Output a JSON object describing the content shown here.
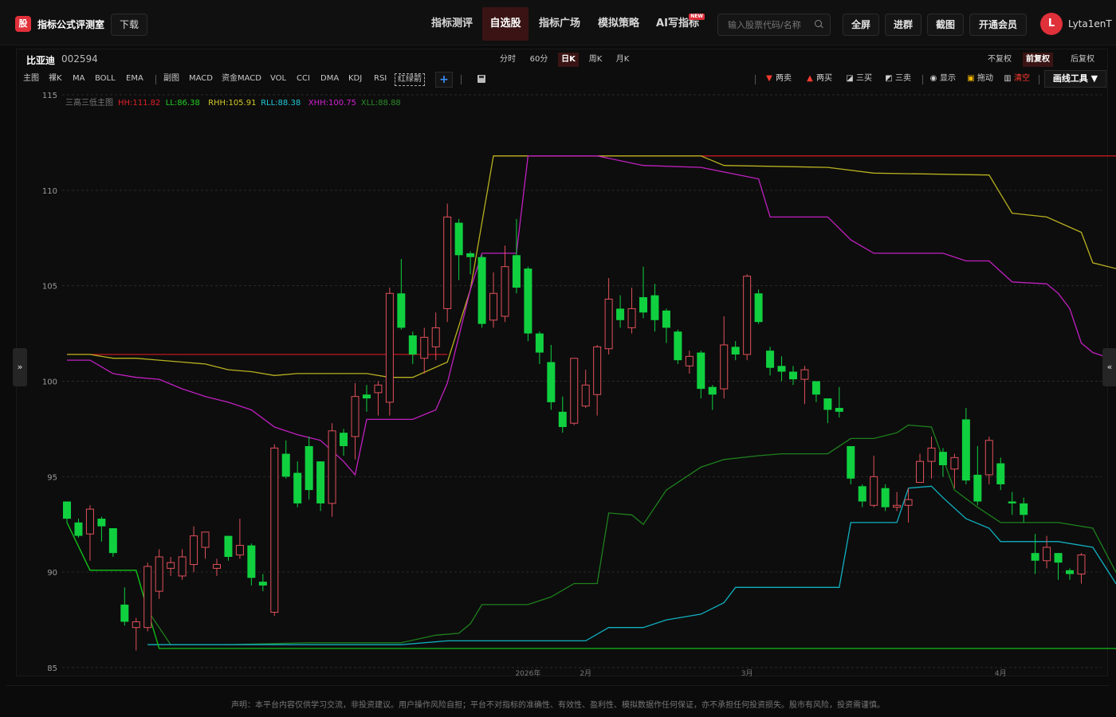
{
  "header": {
    "logo_text": "股",
    "brand": "指标公式评测室",
    "download": "下载",
    "nav": [
      {
        "label": "指标测评",
        "active": false
      },
      {
        "label": "自选股",
        "active": true
      },
      {
        "label": "指标广场",
        "active": false
      },
      {
        "label": "模拟策略",
        "active": false
      },
      {
        "label": "AI写指标",
        "active": false,
        "badge": "NEW"
      }
    ],
    "search_placeholder": "输入股票代码/名称",
    "buttons": [
      "全屏",
      "进群",
      "截图",
      "开通会员"
    ],
    "avatar_letter": "L",
    "username": "Lyta1enT"
  },
  "stock": {
    "name": "比亚迪",
    "code": "002594"
  },
  "periods": [
    {
      "label": "分时",
      "active": false
    },
    {
      "label": "60分",
      "active": false
    },
    {
      "label": "日K",
      "active": true
    },
    {
      "label": "周K",
      "active": false
    },
    {
      "label": "月K",
      "active": false
    }
  ],
  "adjust": [
    {
      "label": "不复权",
      "active": false
    },
    {
      "label": "前复权",
      "active": true
    },
    {
      "label": "后复权",
      "active": false
    }
  ],
  "indicators": [
    "主图",
    "裸K",
    "MA",
    "BOLL",
    "EMA",
    "副图",
    "MACD",
    "资金MACD",
    "VOL",
    "CCI",
    "DMA",
    "KDJ",
    "RSI",
    "红绿箭"
  ],
  "tools": [
    {
      "label": "两卖",
      "glyph": "▼",
      "color": "#ff3b30"
    },
    {
      "label": "两买",
      "glyph": "▲",
      "color": "#ff3b30"
    },
    {
      "label": "三买",
      "glyph": "◪",
      "color": "#cccccc"
    },
    {
      "label": "三卖",
      "glyph": "◩",
      "color": "#cccccc"
    },
    {
      "label": "显示",
      "glyph": "◉",
      "color": "#cccccc"
    },
    {
      "label": "拖动",
      "glyph": "▣",
      "color": "#f0b400"
    },
    {
      "label": "清空",
      "glyph": "▥",
      "color": "#cccccc"
    }
  ],
  "draw_tool": "画线工具 ▼",
  "side_tabs": {
    "left": "»",
    "right": "«"
  },
  "legend": {
    "name": "三高三低主图",
    "items": [
      {
        "text": "HH:111.82",
        "color": "#e0202a"
      },
      {
        "text": "LL:86.38",
        "color": "#22cc22"
      },
      {
        "text": "RHH:105.91",
        "color": "#d4c82a"
      },
      {
        "text": "RLL:88.38",
        "color": "#20c8d8"
      },
      {
        "text": "XHH:100.75",
        "color": "#d020d0"
      },
      {
        "text": "XLL:88.88",
        "color": "#2a8a2a"
      }
    ]
  },
  "colors": {
    "up": "#e0505a",
    "down": "#10d040",
    "bg": "#0d0d0d"
  },
  "chart_data": {
    "type": "candlestick",
    "ylim": [
      85,
      115
    ],
    "yticks": [
      85,
      90,
      95,
      100,
      105,
      110,
      115
    ],
    "xticks": [
      {
        "label": "2026年",
        "index": 40
      },
      {
        "label": "2月",
        "index": 45
      },
      {
        "label": "3月",
        "index": 59
      },
      {
        "label": "4月",
        "index": 81
      }
    ],
    "candles": [
      [
        93.7,
        92.8,
        93.7,
        92.6
      ],
      [
        92.6,
        91.9,
        92.8,
        91.8
      ],
      [
        92.0,
        93.3,
        93.5,
        90.6
      ],
      [
        92.8,
        92.4,
        92.9,
        91.6
      ],
      [
        92.3,
        91.0,
        92.3,
        90.8
      ],
      [
        88.3,
        87.4,
        89.2,
        87.2
      ],
      [
        87.1,
        87.4,
        87.6,
        85.9
      ],
      [
        87.1,
        90.3,
        90.5,
        86.9
      ],
      [
        89.0,
        90.8,
        91.2,
        88.6
      ],
      [
        90.2,
        90.5,
        90.8,
        89.8
      ],
      [
        89.8,
        90.8,
        91.2,
        89.6
      ],
      [
        90.4,
        91.9,
        92.4,
        90.0
      ],
      [
        91.3,
        92.1,
        92.1,
        90.7
      ],
      [
        90.2,
        90.4,
        90.7,
        89.8
      ],
      [
        91.9,
        90.8,
        91.9,
        90.6
      ],
      [
        90.9,
        91.4,
        92.8,
        90.7
      ],
      [
        91.4,
        89.7,
        91.5,
        89.3
      ],
      [
        89.5,
        89.3,
        89.9,
        89.0
      ],
      [
        87.9,
        96.5,
        96.7,
        87.7
      ],
      [
        96.2,
        95.0,
        96.9,
        94.9
      ],
      [
        95.2,
        93.6,
        95.8,
        93.4
      ],
      [
        96.6,
        94.3,
        97.1,
        93.8
      ],
      [
        95.8,
        93.6,
        95.8,
        93.2
      ],
      [
        93.6,
        97.4,
        97.8,
        92.9
      ],
      [
        97.3,
        96.6,
        97.5,
        96.1
      ],
      [
        97.1,
        99.2,
        99.9,
        95.9
      ],
      [
        99.3,
        99.1,
        99.8,
        98.4
      ],
      [
        99.4,
        99.8,
        100.0,
        98.2
      ],
      [
        98.9,
        104.6,
        104.9,
        98.2
      ],
      [
        104.6,
        102.8,
        106.4,
        102.7
      ],
      [
        102.4,
        101.4,
        102.6,
        100.9
      ],
      [
        101.2,
        102.3,
        102.8,
        100.4
      ],
      [
        101.8,
        102.8,
        103.6,
        101.1
      ],
      [
        103.8,
        108.6,
        109.3,
        103.1
      ],
      [
        108.3,
        106.6,
        108.5,
        105.3
      ],
      [
        106.7,
        106.5,
        106.8,
        105.6
      ],
      [
        106.5,
        103.0,
        106.6,
        102.8
      ],
      [
        103.2,
        104.6,
        105.7,
        102.8
      ],
      [
        103.4,
        106.0,
        107.1,
        103.1
      ],
      [
        106.6,
        104.9,
        108.5,
        104.6
      ],
      [
        105.9,
        102.5,
        106.0,
        102.1
      ],
      [
        102.5,
        101.5,
        102.6,
        100.9
      ],
      [
        101.0,
        98.9,
        101.9,
        98.5
      ],
      [
        98.4,
        97.6,
        99.2,
        97.3
      ],
      [
        97.8,
        101.2,
        101.2,
        97.7
      ],
      [
        98.7,
        99.8,
        100.6,
        98.6
      ],
      [
        99.3,
        101.8,
        101.9,
        98.2
      ],
      [
        101.7,
        104.3,
        105.4,
        101.4
      ],
      [
        103.8,
        103.2,
        104.5,
        102.8
      ],
      [
        102.8,
        103.8,
        104.9,
        102.5
      ],
      [
        104.4,
        103.6,
        106.0,
        103.3
      ],
      [
        104.5,
        103.2,
        105.1,
        102.6
      ],
      [
        103.7,
        102.8,
        103.8,
        102.0
      ],
      [
        102.6,
        101.1,
        102.7,
        100.9
      ],
      [
        100.8,
        101.3,
        101.6,
        100.4
      ],
      [
        101.5,
        99.6,
        101.6,
        99.1
      ],
      [
        99.7,
        99.3,
        99.8,
        98.5
      ],
      [
        99.6,
        101.9,
        103.4,
        99.1
      ],
      [
        101.8,
        101.4,
        102.1,
        101.1
      ],
      [
        101.4,
        105.5,
        105.6,
        101.1
      ],
      [
        104.6,
        103.1,
        104.8,
        103.0
      ],
      [
        101.6,
        100.7,
        101.8,
        100.3
      ],
      [
        100.8,
        100.5,
        101.3,
        100.0
      ],
      [
        100.5,
        100.1,
        100.8,
        99.8
      ],
      [
        100.1,
        100.6,
        100.8,
        98.8
      ],
      [
        100.0,
        99.3,
        100.0,
        98.9
      ],
      [
        99.1,
        98.5,
        99.1,
        97.8
      ],
      [
        98.6,
        98.4,
        99.7,
        98.1
      ],
      [
        96.6,
        94.9,
        96.6,
        94.6
      ],
      [
        94.5,
        93.7,
        94.6,
        93.4
      ],
      [
        93.5,
        95.0,
        96.1,
        93.4
      ],
      [
        94.4,
        93.4,
        94.6,
        93.2
      ],
      [
        93.4,
        93.5,
        94.2,
        93.2
      ],
      [
        93.5,
        93.8,
        94.4,
        92.6
      ],
      [
        94.7,
        95.8,
        96.2,
        94.7
      ],
      [
        95.8,
        96.5,
        97.1,
        94.9
      ],
      [
        96.3,
        95.6,
        96.5,
        95.0
      ],
      [
        95.4,
        96.0,
        96.2,
        94.4
      ],
      [
        98.0,
        94.8,
        98.6,
        94.6
      ],
      [
        95.1,
        93.7,
        96.6,
        93.5
      ],
      [
        95.1,
        96.9,
        97.1,
        94.6
      ],
      [
        95.7,
        94.6,
        96.0,
        94.3
      ],
      [
        93.7,
        93.6,
        94.2,
        93.0
      ],
      [
        93.6,
        93.0,
        93.9,
        92.6
      ],
      [
        91.0,
        90.6,
        92.0,
        89.9
      ],
      [
        90.6,
        91.3,
        91.9,
        90.2
      ],
      [
        91.0,
        90.5,
        91.0,
        89.6
      ],
      [
        90.1,
        89.9,
        90.2,
        89.6
      ],
      [
        89.9,
        90.9,
        91.0,
        89.4
      ]
    ],
    "lines": {
      "HH": {
        "color": "#c01820",
        "segments": [
          [
            [
              0,
              101.4
            ],
            [
              33,
              101.4
            ]
          ],
          [
            [
              37,
              111.8
            ],
            [
              95,
              111.8
            ]
          ]
        ]
      },
      "RHH": {
        "color": "#b8b020",
        "points": [
          [
            0,
            101.4
          ],
          [
            2,
            101.4
          ],
          [
            4,
            101.2
          ],
          [
            6,
            101.2
          ],
          [
            8,
            101.1
          ],
          [
            10,
            101.0
          ],
          [
            12,
            100.9
          ],
          [
            14,
            100.6
          ],
          [
            16,
            100.5
          ],
          [
            18,
            100.3
          ],
          [
            20,
            100.4
          ],
          [
            22,
            100.4
          ],
          [
            24,
            100.4
          ],
          [
            26,
            100.4
          ],
          [
            28,
            100.2
          ],
          [
            30,
            100.2
          ],
          [
            33,
            101.0
          ],
          [
            35,
            104.8
          ],
          [
            37,
            111.8
          ],
          [
            45,
            111.8
          ],
          [
            47,
            111.8
          ],
          [
            55,
            111.8
          ],
          [
            57,
            111.3
          ],
          [
            66,
            111.2
          ],
          [
            70,
            110.9
          ],
          [
            80,
            110.8
          ],
          [
            82,
            108.8
          ],
          [
            85,
            108.6
          ],
          [
            88,
            107.8
          ],
          [
            89,
            106.2
          ],
          [
            91,
            105.9
          ],
          [
            95,
            105.9
          ]
        ]
      },
      "XHH": {
        "color": "#c020c0",
        "points": [
          [
            0,
            101.1
          ],
          [
            2,
            101.1
          ],
          [
            4,
            100.4
          ],
          [
            6,
            100.2
          ],
          [
            8,
            100.1
          ],
          [
            10,
            99.6
          ],
          [
            12,
            99.2
          ],
          [
            14,
            98.9
          ],
          [
            16,
            98.5
          ],
          [
            18,
            97.6
          ],
          [
            20,
            97.2
          ],
          [
            22,
            96.9
          ],
          [
            24,
            95.8
          ],
          [
            25,
            95.1
          ],
          [
            26,
            98.0
          ],
          [
            28,
            98.0
          ],
          [
            30,
            98.0
          ],
          [
            32,
            98.5
          ],
          [
            33,
            99.9
          ],
          [
            35,
            104.8
          ],
          [
            36,
            106.7
          ],
          [
            39,
            106.7
          ],
          [
            40,
            111.8
          ],
          [
            46,
            111.8
          ],
          [
            50,
            111.3
          ],
          [
            55,
            111.2
          ],
          [
            60,
            110.6
          ],
          [
            61,
            108.6
          ],
          [
            66,
            108.6
          ],
          [
            68,
            107.4
          ],
          [
            70,
            106.7
          ],
          [
            73,
            106.7
          ],
          [
            76,
            106.7
          ],
          [
            78,
            106.3
          ],
          [
            80,
            106.3
          ],
          [
            82,
            105.2
          ],
          [
            85,
            105.1
          ],
          [
            86,
            104.6
          ],
          [
            87,
            103.8
          ],
          [
            88,
            102.0
          ],
          [
            89,
            101.5
          ],
          [
            92,
            100.9
          ],
          [
            95,
            100.8
          ]
        ]
      },
      "XLL": {
        "color": "#1e801e",
        "points": [
          [
            0,
            92.6
          ],
          [
            2,
            90.1
          ],
          [
            4,
            90.1
          ],
          [
            6,
            90.1
          ],
          [
            7,
            88.0
          ],
          [
            9,
            86.2
          ],
          [
            14,
            86.2
          ],
          [
            21,
            86.3
          ],
          [
            23,
            86.3
          ],
          [
            27,
            86.3
          ],
          [
            29,
            86.3
          ],
          [
            32,
            86.7
          ],
          [
            34,
            86.8
          ],
          [
            35,
            87.3
          ],
          [
            36,
            88.3
          ],
          [
            39,
            88.3
          ],
          [
            40,
            88.3
          ],
          [
            42,
            88.7
          ],
          [
            44,
            89.4
          ],
          [
            46,
            89.4
          ],
          [
            47,
            93.1
          ],
          [
            49,
            93.0
          ],
          [
            50,
            92.5
          ],
          [
            52,
            94.3
          ],
          [
            54,
            95.1
          ],
          [
            55,
            95.5
          ],
          [
            57,
            95.9
          ],
          [
            60,
            96.1
          ],
          [
            62,
            96.2
          ],
          [
            66,
            96.2
          ],
          [
            68,
            97.0
          ],
          [
            70,
            97.0
          ],
          [
            72,
            97.3
          ],
          [
            73,
            97.7
          ],
          [
            75,
            97.6
          ],
          [
            77,
            94.3
          ],
          [
            79,
            93.4
          ],
          [
            81,
            92.6
          ],
          [
            86,
            92.6
          ],
          [
            89,
            92.3
          ],
          [
            91,
            90.0
          ],
          [
            92,
            88.9
          ],
          [
            95,
            88.9
          ]
        ]
      },
      "RLL": {
        "color": "#10b0c0",
        "points": [
          [
            7,
            86.2
          ],
          [
            23,
            86.2
          ],
          [
            29,
            86.2
          ],
          [
            33,
            86.4
          ],
          [
            36,
            86.4
          ],
          [
            45,
            86.4
          ],
          [
            47,
            87.1
          ],
          [
            50,
            87.1
          ],
          [
            52,
            87.5
          ],
          [
            55,
            87.8
          ],
          [
            57,
            88.4
          ],
          [
            58,
            89.2
          ],
          [
            60,
            89.2
          ],
          [
            67,
            89.2
          ],
          [
            68,
            92.6
          ],
          [
            72,
            92.6
          ],
          [
            73,
            94.4
          ],
          [
            75,
            94.5
          ],
          [
            76,
            93.9
          ],
          [
            78,
            92.8
          ],
          [
            80,
            92.3
          ],
          [
            81,
            91.6
          ],
          [
            86,
            91.6
          ],
          [
            89,
            91.3
          ],
          [
            91,
            89.4
          ],
          [
            94,
            88.4
          ],
          [
            95,
            88.4
          ]
        ]
      },
      "LL": {
        "color": "#10c018",
        "points": [
          [
            0,
            92.6
          ],
          [
            2,
            90.1
          ],
          [
            4,
            90.1
          ],
          [
            6,
            90.1
          ],
          [
            7,
            88.0
          ],
          [
            8,
            86.0
          ],
          [
            9,
            86.0
          ],
          [
            95,
            86.0
          ]
        ]
      }
    }
  },
  "footer": {
    "disclaimer": "声明：本平台内容仅供学习交流，非投资建议。用户操作风险自担；平台不对指标的准确性、有效性、盈利性、模拟数据作任何保证，亦不承担任何投资损失。股市有风险，投资需谨慎。"
  }
}
